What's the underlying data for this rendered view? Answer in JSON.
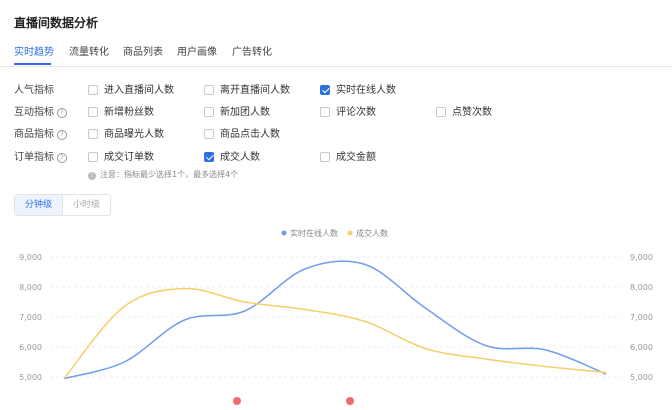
{
  "page_title": "直播间数据分析",
  "tabs": [
    {
      "label": "实时趋势",
      "active": true
    },
    {
      "label": "流量转化",
      "active": false
    },
    {
      "label": "商品列表",
      "active": false
    },
    {
      "label": "用户画像",
      "active": false
    },
    {
      "label": "广告转化",
      "active": false
    }
  ],
  "metric_groups": [
    {
      "label": "人气指标",
      "help": false,
      "options": [
        {
          "label": "进入直播间人数",
          "checked": false
        },
        {
          "label": "离开直播间人数",
          "checked": false
        },
        {
          "label": "实时在线人数",
          "checked": true
        }
      ]
    },
    {
      "label": "互动指标",
      "help": true,
      "options": [
        {
          "label": "新增粉丝数",
          "checked": false
        },
        {
          "label": "新加团人数",
          "checked": false
        },
        {
          "label": "评论次数",
          "checked": false
        },
        {
          "label": "点赞次数",
          "checked": false
        }
      ]
    },
    {
      "label": "商品指标",
      "help": true,
      "options": [
        {
          "label": "商品曝光人数",
          "checked": false
        },
        {
          "label": "商品点击人数",
          "checked": false
        }
      ]
    },
    {
      "label": "订单指标",
      "help": true,
      "options": [
        {
          "label": "成交订单数",
          "checked": false
        },
        {
          "label": "成交人数",
          "checked": true
        },
        {
          "label": "成交金额",
          "checked": false
        }
      ]
    }
  ],
  "note": "注意：指标最少选择1个，最多选择4个",
  "granularity": {
    "minute": "分钟级",
    "hour": "小时级",
    "selected": "minute"
  },
  "chart_data": {
    "type": "line",
    "series": [
      {
        "name": "实时在线人数",
        "color": "#6f9ef0",
        "values": [
          4950,
          5500,
          6900,
          7200,
          8600,
          8750,
          7300,
          6050,
          5900,
          5100
        ]
      },
      {
        "name": "成交人数",
        "color": "#f7cf6a",
        "values": [
          4950,
          7350,
          7950,
          7500,
          7250,
          6850,
          5950,
          5600,
          5350,
          5150
        ]
      }
    ],
    "legend_position": "top-center",
    "ylim": [
      5000,
      9000
    ],
    "yticks": [
      "9,000",
      "8,000",
      "7,000",
      "6,000",
      "5,000"
    ],
    "grid": true,
    "dual_y_axis": true
  }
}
